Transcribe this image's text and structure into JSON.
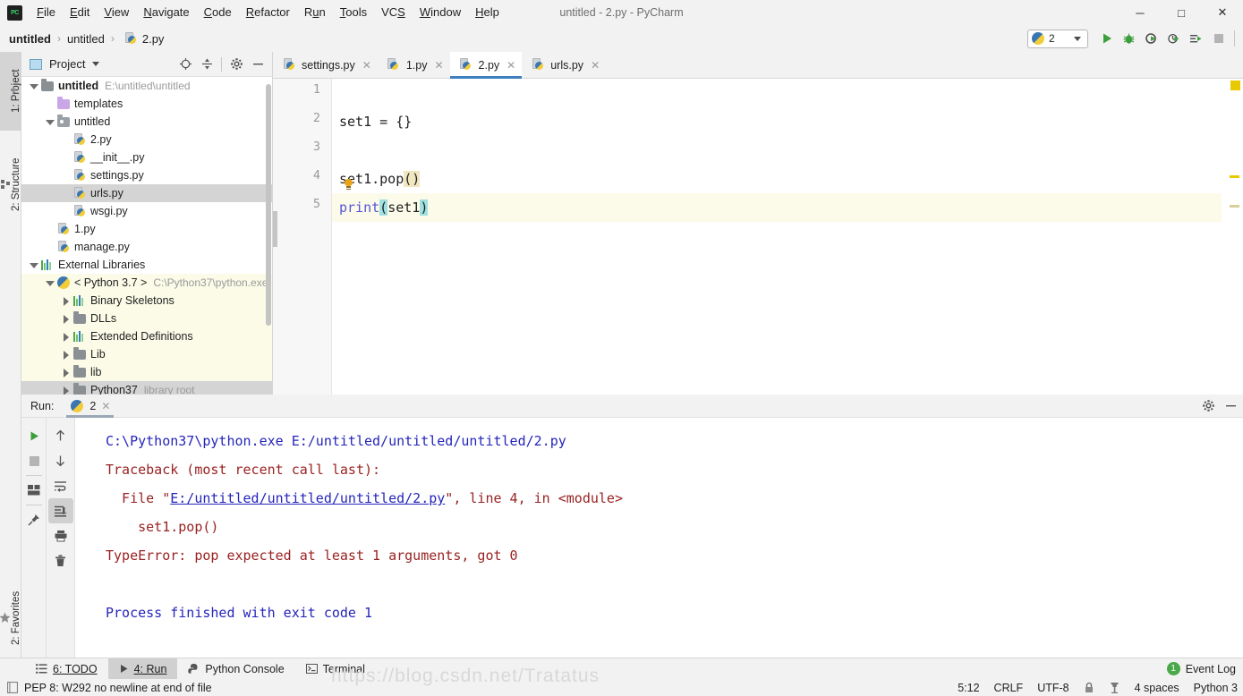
{
  "window": {
    "title": "untitled - 2.py - PyCharm",
    "logo_text": "PC",
    "minimize": "─",
    "maximize": "□",
    "close": "✕"
  },
  "menu": [
    {
      "label": "File"
    },
    {
      "label": "Edit"
    },
    {
      "label": "View"
    },
    {
      "label": "Navigate"
    },
    {
      "label": "Code"
    },
    {
      "label": "Refactor"
    },
    {
      "label": "Run"
    },
    {
      "label": "Tools"
    },
    {
      "label": "VCS"
    },
    {
      "label": "Window"
    },
    {
      "label": "Help"
    }
  ],
  "breadcrumb": {
    "items": [
      "untitled",
      "untitled",
      "2.py"
    ],
    "separator": "›"
  },
  "run_toolbar": {
    "config_name": "2",
    "icons": [
      "run-icon",
      "debug-icon",
      "run-with-coverage-icon",
      "profile-icon",
      "run-tests-icon",
      "stop-icon"
    ]
  },
  "left_strips": {
    "project": "1: Project",
    "structure": "2: Structure",
    "favorites": "2: Favorites"
  },
  "project_panel": {
    "title": "Project",
    "tools": [
      "locate-icon",
      "collapse-all-icon",
      "settings-gear-icon",
      "hide-icon"
    ],
    "tree": [
      {
        "label": "untitled",
        "path": "E:\\untitled\\untitled",
        "icon": "folder-icon",
        "indent": 0,
        "arrow": "down",
        "bold": true
      },
      {
        "label": "templates",
        "path": "",
        "icon": "folder-purple-icon",
        "indent": 1,
        "arrow": "none",
        "bold": false
      },
      {
        "label": "untitled",
        "path": "",
        "icon": "folder-source-icon",
        "indent": 1,
        "arrow": "down",
        "bold": false
      },
      {
        "label": "2.py",
        "path": "",
        "icon": "python-file-icon",
        "indent": 2,
        "arrow": "none",
        "bold": false
      },
      {
        "label": "__init__.py",
        "path": "",
        "icon": "python-file-icon",
        "indent": 2,
        "arrow": "none",
        "bold": false
      },
      {
        "label": "settings.py",
        "path": "",
        "icon": "python-file-icon",
        "indent": 2,
        "arrow": "none",
        "bold": false
      },
      {
        "label": "urls.py",
        "path": "",
        "icon": "python-file-icon",
        "indent": 2,
        "arrow": "none",
        "bold": false,
        "selected": true
      },
      {
        "label": "wsgi.py",
        "path": "",
        "icon": "python-file-icon",
        "indent": 2,
        "arrow": "none",
        "bold": false
      },
      {
        "label": "1.py",
        "path": "",
        "icon": "python-file-icon",
        "indent": 1,
        "arrow": "none",
        "bold": false
      },
      {
        "label": "manage.py",
        "path": "",
        "icon": "python-file-icon",
        "indent": 1,
        "arrow": "none",
        "bold": false
      },
      {
        "label": "External Libraries",
        "path": "",
        "icon": "library-icon",
        "indent": 0,
        "arrow": "down",
        "bold": false
      },
      {
        "label": "< Python 3.7 >",
        "path": "C:\\Python37\\python.exe",
        "icon": "python-logo-icon",
        "indent": 1,
        "arrow": "down",
        "bold": false,
        "lib": true
      },
      {
        "label": "Binary Skeletons",
        "path": "",
        "icon": "library-icon",
        "indent": 2,
        "arrow": "right",
        "bold": false,
        "lib": true
      },
      {
        "label": "DLLs",
        "path": "",
        "icon": "folder-icon",
        "indent": 2,
        "arrow": "right",
        "bold": false,
        "lib": true
      },
      {
        "label": "Extended Definitions",
        "path": "",
        "icon": "library-icon",
        "indent": 2,
        "arrow": "right",
        "bold": false,
        "lib": true
      },
      {
        "label": "Lib",
        "path": "",
        "icon": "folder-icon",
        "indent": 2,
        "arrow": "right",
        "bold": false,
        "lib": true
      },
      {
        "label": "lib",
        "path": "",
        "icon": "folder-icon",
        "indent": 2,
        "arrow": "right",
        "bold": false,
        "lib": true
      },
      {
        "label": "Python37",
        "path": "library root",
        "icon": "folder-icon",
        "indent": 2,
        "arrow": "right",
        "bold": false,
        "selected2": true
      }
    ]
  },
  "editor": {
    "tabs": [
      {
        "label": "settings.py",
        "active": false
      },
      {
        "label": "1.py",
        "active": false
      },
      {
        "label": "2.py",
        "active": true
      },
      {
        "label": "urls.py",
        "active": false
      }
    ],
    "close_glyph": "✕",
    "line_numbers": [
      "1",
      "2",
      "3",
      "4",
      "5"
    ],
    "lines": [
      {
        "n": 1,
        "text": ""
      },
      {
        "n": 2,
        "text": "set1 = {}"
      },
      {
        "n": 3,
        "text": ""
      },
      {
        "n": 4,
        "text": "set1.pop()"
      },
      {
        "n": 5,
        "text": "print(set1)"
      }
    ],
    "line4": {
      "before": "set1.pop",
      "paren": "()"
    },
    "line5": {
      "kw": "print",
      "open": "(",
      "arg": "set1",
      "close": ")"
    },
    "current_line": 5
  },
  "run_window": {
    "label": "Run:",
    "tab_name": "2",
    "close_glyph": "✕",
    "header_icons": [
      "settings-gear-icon",
      "hide-icon"
    ],
    "toolbar_left": [
      "rerun-icon",
      "stop-icon",
      "layout-icon",
      "pin-icon"
    ],
    "toolbar_right": [
      "up-icon",
      "down-icon",
      "soft-wrap-icon",
      "scroll-to-end-icon",
      "print-icon",
      "clear-all-icon"
    ],
    "console_lines": [
      {
        "type": "cmd",
        "text": "C:\\Python37\\python.exe E:/untitled/untitled/untitled/2.py"
      },
      {
        "type": "err",
        "text": "Traceback (most recent call last):"
      },
      {
        "type": "err_link",
        "prefix": "  File \"",
        "link": "E:/untitled/untitled/untitled/2.py",
        "suffix": "\", line 4, in <module>"
      },
      {
        "type": "err",
        "text": "    set1.pop()"
      },
      {
        "type": "err",
        "text": "TypeError: pop expected at least 1 arguments, got 0"
      },
      {
        "type": "blank",
        "text": ""
      },
      {
        "type": "cmd",
        "text": "Process finished with exit code 1"
      }
    ]
  },
  "bottom_bar": {
    "items": [
      {
        "label": "6: TODO",
        "icon": "todo-icon",
        "active": false
      },
      {
        "label": "4: Run",
        "icon": "run-icon",
        "active": true
      },
      {
        "label": "Python Console",
        "icon": "python-console-icon",
        "active": false
      },
      {
        "label": "Terminal",
        "icon": "terminal-icon",
        "active": false
      }
    ],
    "event_log": "Event Log",
    "event_count": "1"
  },
  "status_bar": {
    "inspection": "PEP 8: W292 no newline at end of file",
    "caret": "5:12",
    "line_sep": "CRLF",
    "encoding": "UTF-8",
    "indent": "4 spaces",
    "interpreter": "Python 3",
    "icons": [
      "lock-icon",
      "hammer-icon"
    ]
  },
  "watermark": {
    "text": "https://blog.csdn.net/Tratatus"
  },
  "colors": {
    "accent_tab": "#3d7fbf",
    "warning": "#e8c800",
    "error_text": "#992222",
    "link": "#2525bb",
    "builtin": "#5656d6",
    "current_line": "#fcfae8",
    "bracket_match": "#9fe0e0"
  }
}
